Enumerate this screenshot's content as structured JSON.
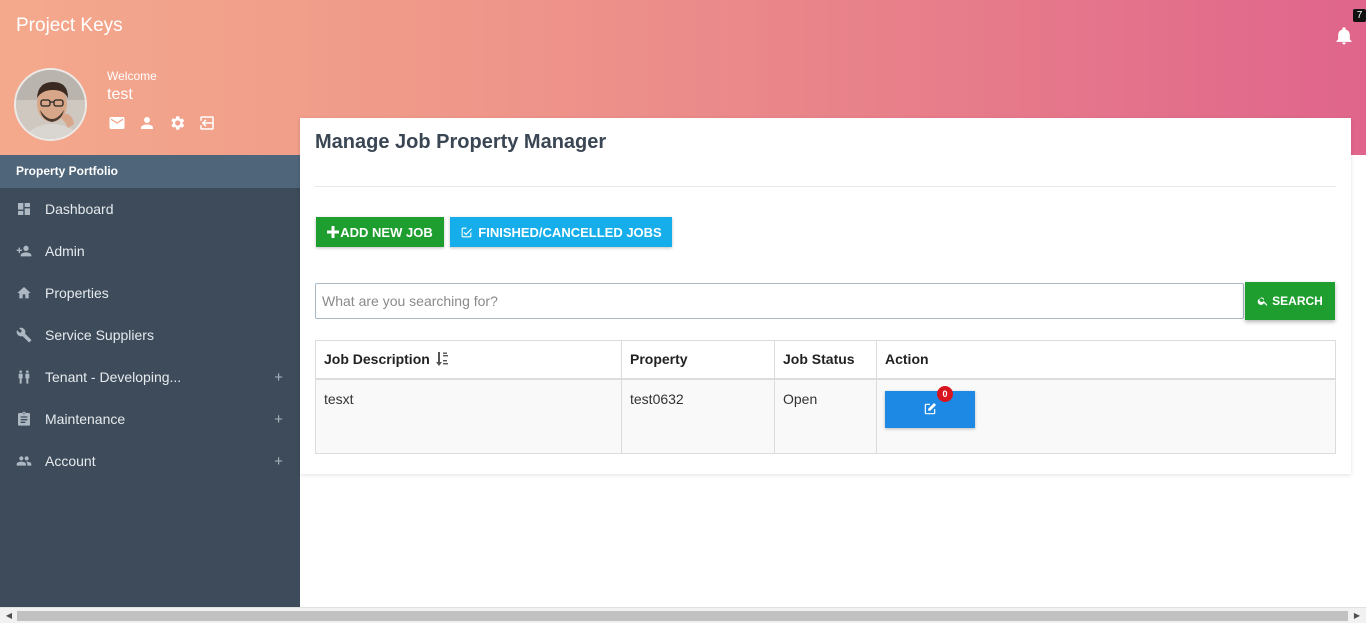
{
  "app": {
    "title": "Project Keys"
  },
  "notifications": {
    "count": "7"
  },
  "profile": {
    "welcome": "Welcome",
    "username": "test",
    "icons": [
      "mail-icon",
      "user-icon",
      "gear-icon",
      "logout-icon"
    ]
  },
  "sidebar": {
    "section": "Property Portfolio",
    "items": [
      {
        "label": "Dashboard",
        "icon": "dashboard-icon",
        "expandable": false
      },
      {
        "label": "Admin",
        "icon": "add-user-icon",
        "expandable": false
      },
      {
        "label": "Properties",
        "icon": "home-icon",
        "expandable": false
      },
      {
        "label": "Service Suppliers",
        "icon": "wrench-icon",
        "expandable": false
      },
      {
        "label": "Tenant - Developing...",
        "icon": "people-icon",
        "expandable": true,
        "expand_symbol": "+"
      },
      {
        "label": "Maintenance",
        "icon": "clipboard-icon",
        "expandable": true,
        "expand_symbol": "+"
      },
      {
        "label": "Account",
        "icon": "group-icon",
        "expandable": true,
        "expand_symbol": "+"
      }
    ]
  },
  "main": {
    "title": "Manage Job Property Manager",
    "add_button": "ADD NEW JOB",
    "finished_button": "FINISHED/CANCELLED JOBS",
    "search": {
      "placeholder": "What are you searching for?",
      "button": "SEARCH"
    },
    "table": {
      "headers": [
        "Job Description",
        "Property",
        "Job Status",
        "Action"
      ],
      "rows": [
        {
          "description": "tesxt",
          "property": "test0632",
          "status": "Open",
          "badge": "0"
        }
      ]
    }
  },
  "colors": {
    "green": "#1f9e30",
    "cyan": "#15aeea",
    "blue": "#1e88e5",
    "sidebar": "#3d4b5a",
    "badge_red": "#d8141e"
  }
}
